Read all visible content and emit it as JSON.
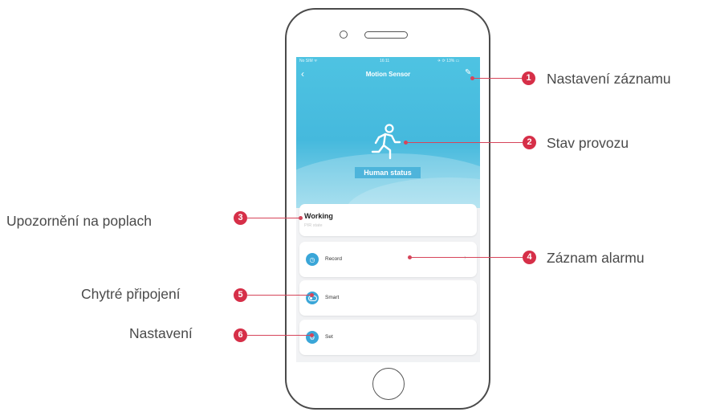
{
  "app": {
    "status_bar": {
      "carrier": "No SIM ᯤ",
      "time": "16:11",
      "battery": "✈ ⟳ 13% ▭"
    },
    "title": "Motion Sensor",
    "back_icon": "‹",
    "edit_icon": "✎",
    "hero_label": "Human status",
    "status_card": {
      "title": "Working",
      "subtitle": "PIR state"
    },
    "rows": [
      {
        "label": "Record",
        "icon": "clock-icon"
      },
      {
        "label": "Smart",
        "icon": "toggle-icon"
      },
      {
        "label": "Set",
        "icon": "gear-icon"
      }
    ],
    "accent_color": "#3aa6d8"
  },
  "callouts": [
    {
      "number": "1",
      "text": "Nastavení záznamu"
    },
    {
      "number": "2",
      "text": "Stav provozu"
    },
    {
      "number": "3",
      "text": "Upozornění na poplach"
    },
    {
      "number": "4",
      "text": "Záznam alarmu"
    },
    {
      "number": "5",
      "text": "Chytré připojení"
    },
    {
      "number": "6",
      "text": "Nastavení"
    }
  ],
  "callout_color": "#d62f48"
}
